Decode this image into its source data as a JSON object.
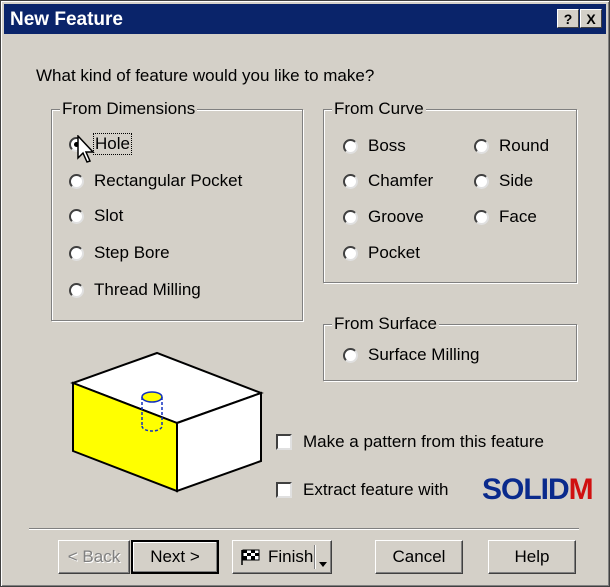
{
  "window": {
    "title": "New Feature",
    "help_btn": "?",
    "close_btn": "X"
  },
  "prompt": "What kind of feature would you like to make?",
  "groups": {
    "dimensions": {
      "legend": "From Dimensions",
      "options": [
        "Hole",
        "Rectangular Pocket",
        "Slot",
        "Step Bore",
        "Thread Milling"
      ],
      "selected": "Hole"
    },
    "curve": {
      "legend": "From Curve",
      "options": [
        "Boss",
        "Chamfer",
        "Groove",
        "Pocket",
        "Round",
        "Side",
        "Face"
      ]
    },
    "surface": {
      "legend": "From Surface",
      "options": [
        "Surface Milling"
      ]
    }
  },
  "checkboxes": {
    "pattern": {
      "label": "Make a pattern from this feature",
      "checked": false
    },
    "extract": {
      "label": "Extract feature with",
      "checked": false
    }
  },
  "logo": {
    "part1": "SOLID",
    "part2": "M"
  },
  "buttons": {
    "back": "< Back",
    "next": "Next >",
    "finish": "Finish",
    "cancel": "Cancel",
    "help": "Help"
  },
  "colors": {
    "titlebar": "#0a246a",
    "dialog": "#d4d0c8",
    "box_front": "#ffff00",
    "logo_blue": "#0a2a8c",
    "logo_red": "#d01010"
  }
}
